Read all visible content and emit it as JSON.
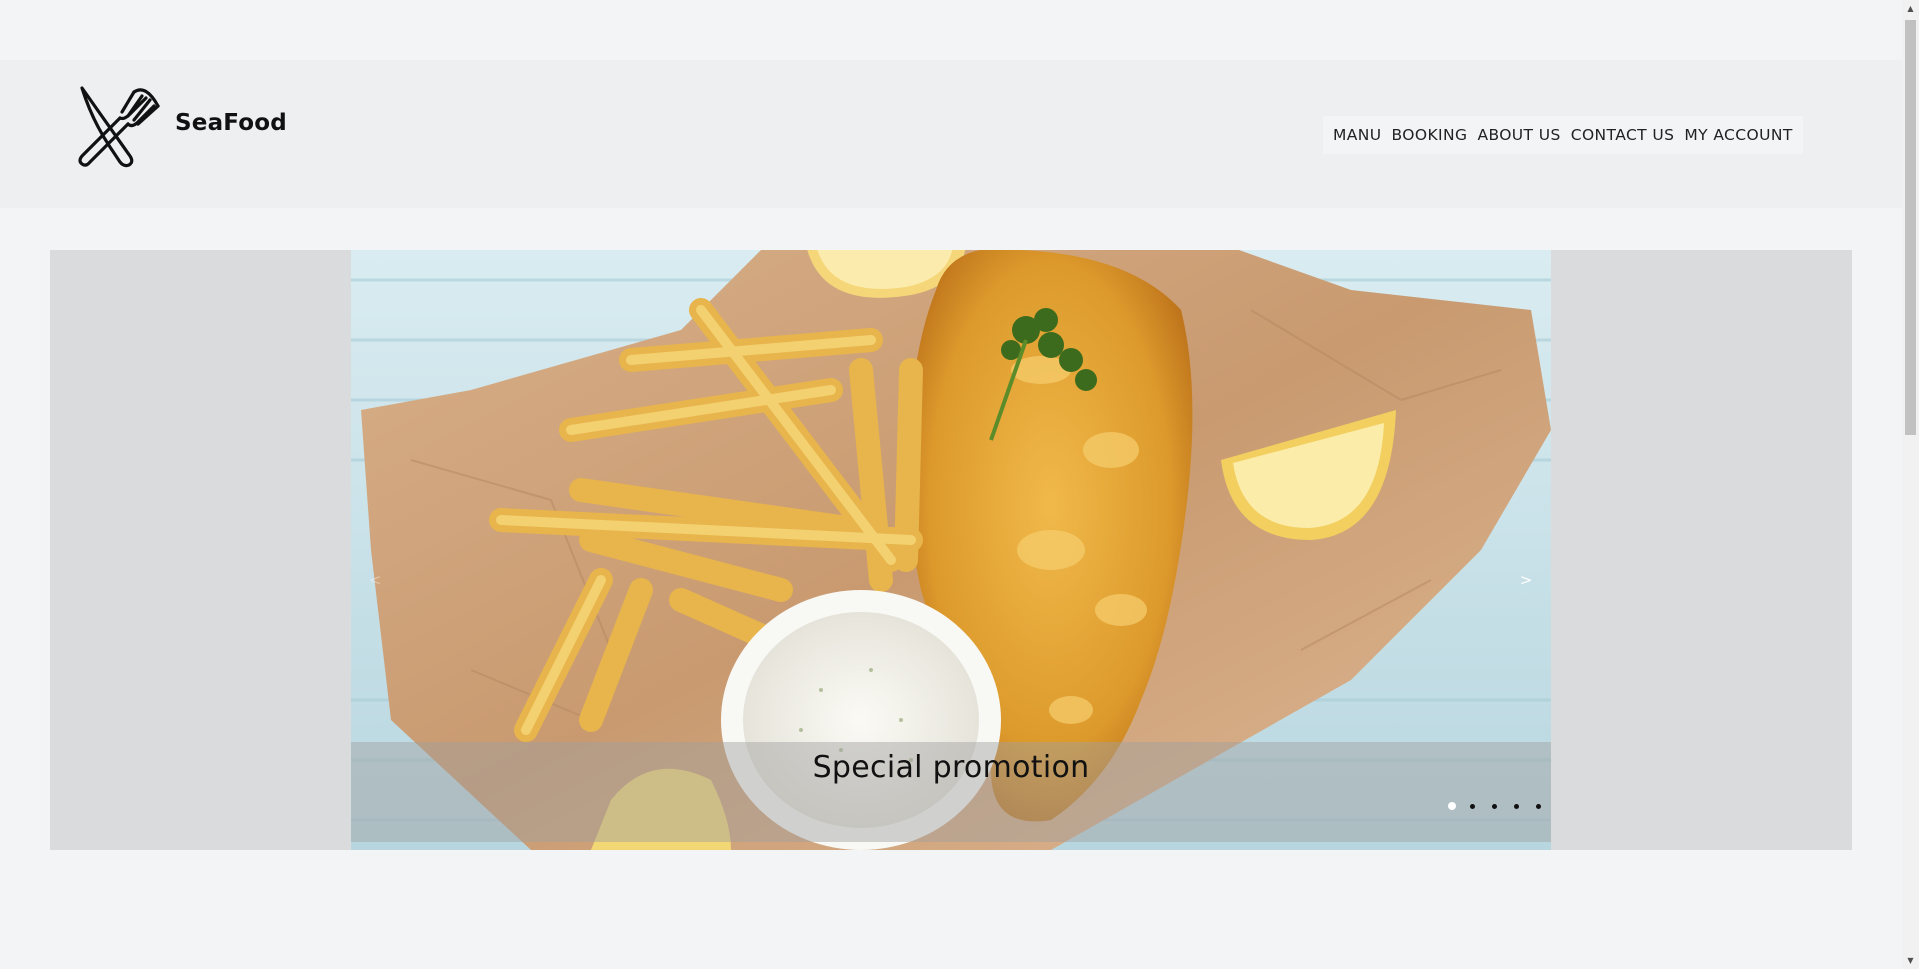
{
  "header": {
    "brand": "SeaFood"
  },
  "nav": {
    "items": [
      "MANU",
      "BOOKING",
      "ABOUT US",
      "CONTACT US",
      "MY ACCOUNT"
    ]
  },
  "carousel": {
    "caption": "Special promotion",
    "prev_label": "<",
    "next_label": ">",
    "slide_count": 5,
    "active_index": 0
  },
  "scrollbar": {
    "up_label": "▲",
    "down_label": "▼"
  },
  "icons": {
    "logo": "knife-fork-icon"
  },
  "colors": {
    "page_bg": "#f3f4f6",
    "header_bg": "#eeeff1",
    "carousel_bg": "#dadbdc"
  }
}
